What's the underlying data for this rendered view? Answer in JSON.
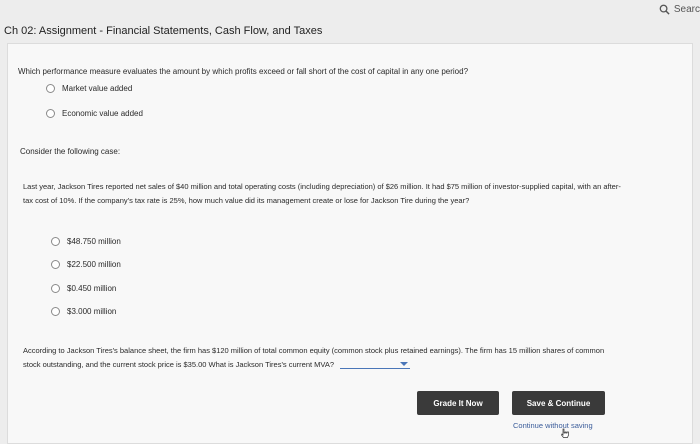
{
  "header": {
    "search_label": "Searc",
    "title": "Ch 02: Assignment - Financial Statements, Cash Flow, and Taxes"
  },
  "q1": {
    "prompt": "Which performance measure evaluates the amount by which profits exceed or fall short of the cost of capital in any one period?",
    "options": [
      "Market value added",
      "Economic value added"
    ]
  },
  "case_heading": "Consider the following case:",
  "q2": {
    "paragraph": "Last year, Jackson Tires reported net sales of $40 million and total operating costs (including depreciation) of $26 million. It had $75 million of investor-supplied capital, with an after-tax cost of 10%. If the company's tax rate is 25%, how much value did its management create or lose for Jackson Tire during the year?",
    "options": [
      "$48.750 million",
      "$22.500 million",
      "$0.450 million",
      "$3.000 million"
    ]
  },
  "q3": {
    "paragraph": "According to Jackson Tires's balance sheet, the firm has $120 million of total common equity (common stock plus retained earnings). The firm has 15 million shares of common stock outstanding, and the current stock price is $35.00 What is Jackson Tires's current MVA?"
  },
  "footer": {
    "grade_label": "Grade It Now",
    "save_label": "Save & Continue",
    "continue_label": "Continue without saving"
  }
}
